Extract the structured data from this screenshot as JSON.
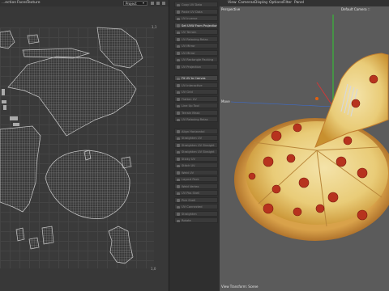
{
  "uv_editor": {
    "menu": [
      "...ection",
      "Faces",
      "Texture"
    ],
    "dropdown": "Project",
    "corner_top": "1,1",
    "corner_bottom": "1,0"
  },
  "tools": {
    "items": [
      {
        "label": "Copy UV Data",
        "hl": false
      },
      {
        "label": "Paste UV Data",
        "hl": false
      },
      {
        "label": "UV Inverse",
        "hl": false
      },
      {
        "label": "Set UVW From Projection",
        "hl": true
      },
      {
        "label": "UV Terrain",
        "hl": false
      },
      {
        "label": "UV Relaxing Relax",
        "hl": false
      },
      {
        "label": "UV Mirror",
        "hl": false
      },
      {
        "label": "UV Mirror",
        "hl": false
      },
      {
        "label": "UV Rectangle Packing",
        "hl": false
      },
      {
        "label": "UV Projection",
        "hl": false
      },
      {
        "label": "Fit UV to Canvas",
        "hl": true
      },
      {
        "label": "UV Interactive",
        "hl": false
      },
      {
        "label": "UV Grid",
        "hl": false
      },
      {
        "label": "Flatten UV",
        "hl": false
      },
      {
        "label": "Line Up Tool",
        "hl": false
      },
      {
        "label": "Terrain Mask",
        "hl": false
      },
      {
        "label": "UV Relaxing Relax",
        "hl": false
      },
      {
        "label": "Align Horizontal",
        "hl": false
      },
      {
        "label": "Straighten UV",
        "hl": false
      },
      {
        "label": "Straighten UV Straight",
        "hl": false
      },
      {
        "label": "Straighten UV Straight",
        "hl": false
      },
      {
        "label": "Sticky UV",
        "hl": false
      },
      {
        "label": "Stitch UV",
        "hl": false
      },
      {
        "label": "Weld UV",
        "hl": false
      },
      {
        "label": "Layout Pack",
        "hl": false
      },
      {
        "label": "Weld Vertex",
        "hl": false
      },
      {
        "label": "UV Pos Shell",
        "hl": false
      },
      {
        "label": "Pick Shell",
        "hl": false
      },
      {
        "label": "UV Connected",
        "hl": false
      },
      {
        "label": "Straighten",
        "hl": false
      },
      {
        "label": "Rotate",
        "hl": false
      }
    ]
  },
  "viewport": {
    "menu": [
      "View",
      "Cameras",
      "Display",
      "Options",
      "Filter",
      "Panel"
    ],
    "label_view": "Perspective",
    "label_camera": "Default Camera ::",
    "label_move": "Move",
    "status": "View Transform: Scene",
    "colors": {
      "axis_x": "#d03838",
      "axis_y": "#32c832",
      "axis_z": "#3a6ed8"
    }
  }
}
